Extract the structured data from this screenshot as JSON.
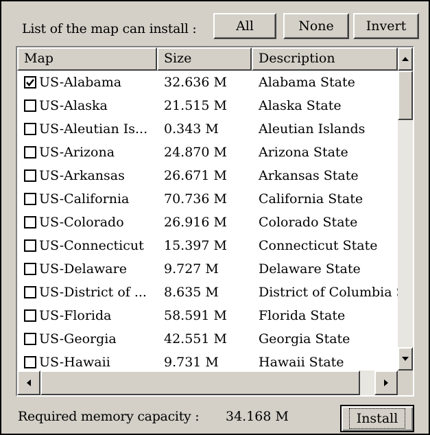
{
  "toolbar": {
    "label": "List of the map can install :",
    "all_label": "All",
    "none_label": "None",
    "invert_label": "Invert"
  },
  "table": {
    "columns": [
      "Map",
      "Size",
      "Description"
    ],
    "rows": [
      {
        "map": "US-Alabama",
        "size": "32.636 M",
        "description": "Alabama State",
        "checked": true
      },
      {
        "map": "US-Alaska",
        "size": "21.515 M",
        "description": "Alaska State",
        "checked": false
      },
      {
        "map": "US-Aleutian Is...",
        "size": "0.343 M",
        "description": "Aleutian Islands",
        "checked": false
      },
      {
        "map": "US-Arizona",
        "size": "24.870 M",
        "description": "Arizona State",
        "checked": false
      },
      {
        "map": "US-Arkansas",
        "size": "26.671 M",
        "description": "Arkansas State",
        "checked": false
      },
      {
        "map": "US-California",
        "size": "70.736 M",
        "description": "California State",
        "checked": false
      },
      {
        "map": "US-Colorado",
        "size": "26.916 M",
        "description": "Colorado State",
        "checked": false
      },
      {
        "map": "US-Connecticut",
        "size": "15.397 M",
        "description": "Connecticut State",
        "checked": false
      },
      {
        "map": "US-Delaware",
        "size": "9.727 M",
        "description": "Delaware State",
        "checked": false
      },
      {
        "map": "US-District of ...",
        "size": "8.635 M",
        "description": "District of Columbia Sta",
        "checked": false
      },
      {
        "map": "US-Florida",
        "size": "58.591 M",
        "description": "Florida State",
        "checked": false
      },
      {
        "map": "US-Georgia",
        "size": "42.551 M",
        "description": "Georgia State",
        "checked": false
      },
      {
        "map": "US-Hawaii",
        "size": "9.731 M",
        "description": "Hawaii State",
        "checked": false
      }
    ]
  },
  "footer": {
    "memory_label": "Required memory capacity :",
    "memory_value": "34.168 M",
    "install_label": "Install"
  },
  "icons": {
    "checkbox_checked": "check-mark",
    "scroll_up": "triangle-up",
    "scroll_down": "triangle-down",
    "scroll_left": "triangle-left",
    "scroll_right": "triangle-right"
  },
  "colors": {
    "face": "#d4d0c8",
    "list_background": "#ffffff"
  }
}
